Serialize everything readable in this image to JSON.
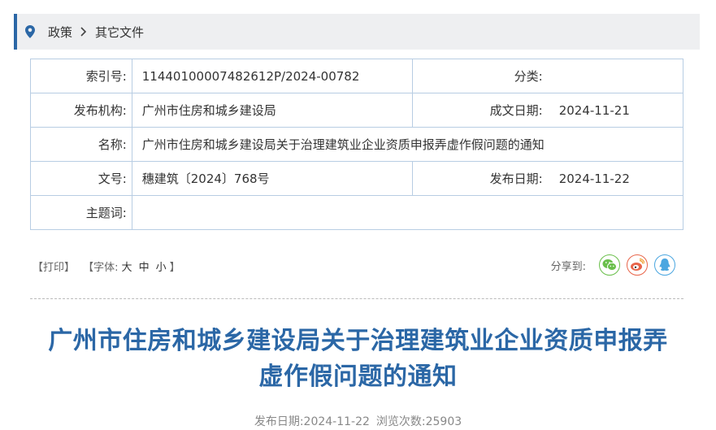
{
  "breadcrumb": {
    "items": [
      "政策",
      "其它文件"
    ]
  },
  "meta": {
    "index_no_label": "索引号:",
    "index_no": "11440100007482612P/2024-00782",
    "category_label": "分类:",
    "category": "",
    "issuer_label": "发布机构:",
    "issuer": "广州市住房和城乡建设局",
    "created_label": "成文日期:",
    "created": "2024-11-21",
    "name_label": "名称:",
    "name": "广州市住房和城乡建设局关于治理建筑业企业资质申报弄虚作假问题的通知",
    "doc_no_label": "文号:",
    "doc_no": "穗建筑〔2024〕768号",
    "published_label": "发布日期:",
    "published": "2024-11-22",
    "keywords_label": "主题词:",
    "keywords": ""
  },
  "tools": {
    "print": "【打印】",
    "font_prefix": "【字体:",
    "font_large": "大",
    "font_medium": "中",
    "font_small": "小",
    "font_suffix": "】"
  },
  "share": {
    "label": "分享到:",
    "icons": [
      "wechat-icon",
      "weibo-icon",
      "qq-icon"
    ],
    "colors": {
      "wechat": "#6abf4b",
      "weibo": "#e8654a",
      "qq": "#4aa6e0"
    }
  },
  "article": {
    "title_line1": "广州市住房和城乡建设局关于治理建筑业企业资质申报弄",
    "title_line2": "虚作假问题的通知",
    "pub_date": "发布日期:2024-11-22",
    "views": "浏览次数:25903"
  },
  "colors": {
    "accent": "#2b67a6",
    "table_border": "#b8cde3",
    "breadcrumb_bg": "#eeeff1"
  }
}
